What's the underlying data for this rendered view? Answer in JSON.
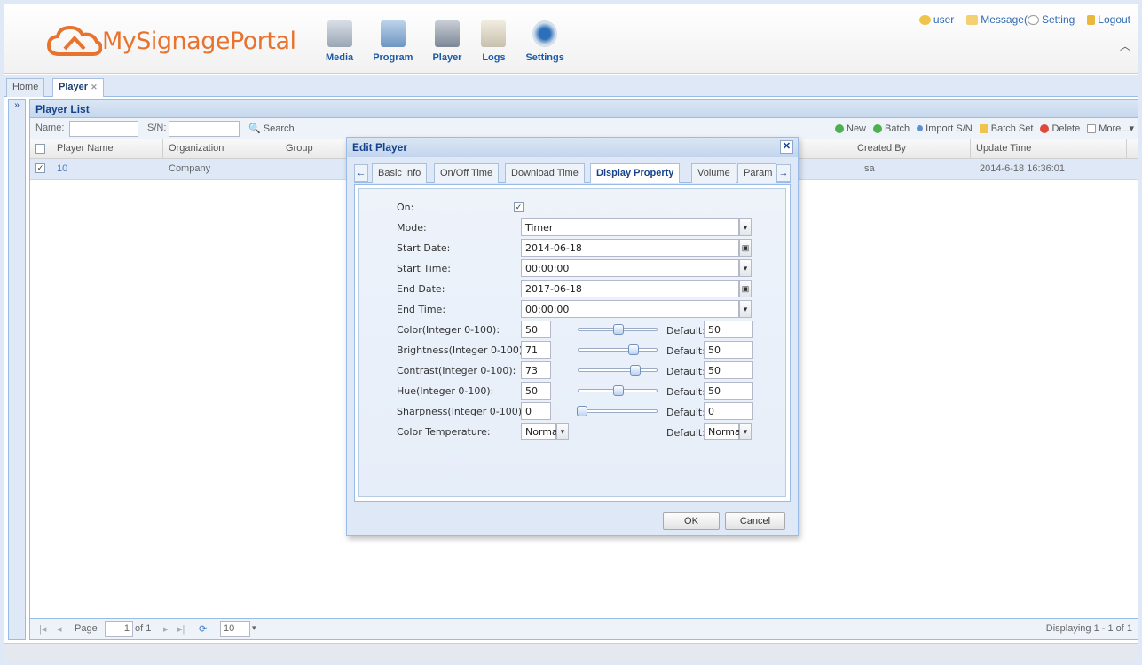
{
  "header": {
    "logo_text": "MySignagePortal",
    "nav": [
      {
        "label": "Media",
        "icon": "media-icon"
      },
      {
        "label": "Program",
        "icon": "program-icon"
      },
      {
        "label": "Player",
        "icon": "player-icon"
      },
      {
        "label": "Logs",
        "icon": "logs-icon"
      },
      {
        "label": "Settings",
        "icon": "settings-icon"
      }
    ],
    "user": "user",
    "message": "Message(",
    "setting": "Setting",
    "logout": "Logout"
  },
  "tabs": {
    "home": "Home",
    "player": "Player"
  },
  "panel": {
    "title": "Player List",
    "name_label": "Name:",
    "sn_label": "S/N:",
    "search": "Search",
    "actions": {
      "new": "New",
      "batch": "Batch",
      "import": "Import S/N",
      "batch_set": "Batch Set",
      "delete": "Delete",
      "more": "More..."
    },
    "columns": {
      "name": "Player Name",
      "org": "Organization",
      "group": "Group",
      "created": "Created By",
      "updated": "Update Time"
    },
    "rows": [
      {
        "name": "10",
        "org": "Company",
        "created": "sa",
        "updated": "2014-6-18 16:36:01"
      }
    ]
  },
  "pager": {
    "page_label": "Page",
    "page_value": "1",
    "of_label": "of 1",
    "page_size": "10",
    "displaying": "Displaying 1 - 1 of 1"
  },
  "dialog": {
    "title": "Edit Player",
    "tabs": [
      "Basic Info",
      "On/Off Time",
      "Download Time",
      "Display Property",
      "Volume",
      "Param"
    ],
    "active_tab": "Display Property",
    "fields": {
      "on_label": "On:",
      "mode_label": "Mode:",
      "mode_value": "Timer",
      "start_date_label": "Start Date:",
      "start_date_value": "2014-06-18",
      "start_time_label": "Start Time:",
      "start_time_value": "00:00:00",
      "end_date_label": "End Date:",
      "end_date_value": "2017-06-18",
      "end_time_label": "End Time:",
      "end_time_value": "00:00:00",
      "color_label": "Color(Integer 0-100):",
      "color_value": "50",
      "color_default": "50",
      "brightness_label": "Brightness(Integer 0-100):",
      "brightness_value": "71",
      "brightness_default": "50",
      "contrast_label": "Contrast(Integer 0-100):",
      "contrast_value": "73",
      "contrast_default": "50",
      "hue_label": "Hue(Integer 0-100):",
      "hue_value": "50",
      "hue_default": "50",
      "sharpness_label": "Sharpness(Integer 0-100):",
      "sharpness_value": "0",
      "sharpness_default": "0",
      "temp_label": "Color Temperature:",
      "temp_value": "Normal",
      "temp_default": "Normal",
      "default_label": "Default:"
    },
    "ok": "OK",
    "cancel": "Cancel"
  },
  "colors": {
    "accent": "#15428b",
    "logo": "#e8732e",
    "panel_bg": "#dfe8f6"
  }
}
